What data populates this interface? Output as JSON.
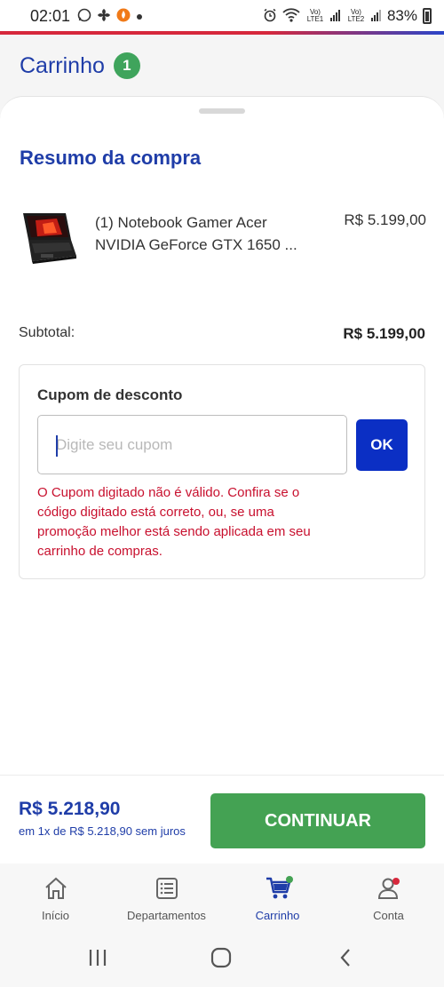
{
  "status": {
    "time": "02:01",
    "battery": "83%",
    "sim1": "Vo) LTE1",
    "sim2": "Vo) LTE2"
  },
  "header": {
    "title": "Carrinho",
    "badge": "1"
  },
  "summary": {
    "title": "Resumo da compra"
  },
  "product": {
    "name": "(1) Notebook Gamer Acer NVIDIA GeForce GTX 1650 ...",
    "price": "R$ 5.199,00",
    "image": "laptop-icon"
  },
  "subtotal": {
    "label": "Subtotal:",
    "value": "R$ 5.199,00"
  },
  "coupon": {
    "label": "Cupom de desconto",
    "placeholder": "Digite seu cupom",
    "value": "",
    "button": "OK",
    "error": "O Cupom digitado não é válido. Confira se o código digitado está correto, ou, se uma promoção melhor está sendo aplicada em seu carrinho de compras."
  },
  "checkout": {
    "total": "R$ 5.218,90",
    "installments": "em 1x de R$ 5.218,90 sem juros",
    "button": "CONTINUAR"
  },
  "tabs": [
    {
      "label": "Início",
      "icon": "home-icon"
    },
    {
      "label": "Departamentos",
      "icon": "list-icon"
    },
    {
      "label": "Carrinho",
      "icon": "cart-icon"
    },
    {
      "label": "Conta",
      "icon": "account-icon"
    }
  ],
  "colors": {
    "brand_blue": "#1f3da8",
    "button_blue": "#0b2fc4",
    "success_green": "#44a253",
    "badge_green": "#3fa45c",
    "error_red": "#c8102e"
  }
}
